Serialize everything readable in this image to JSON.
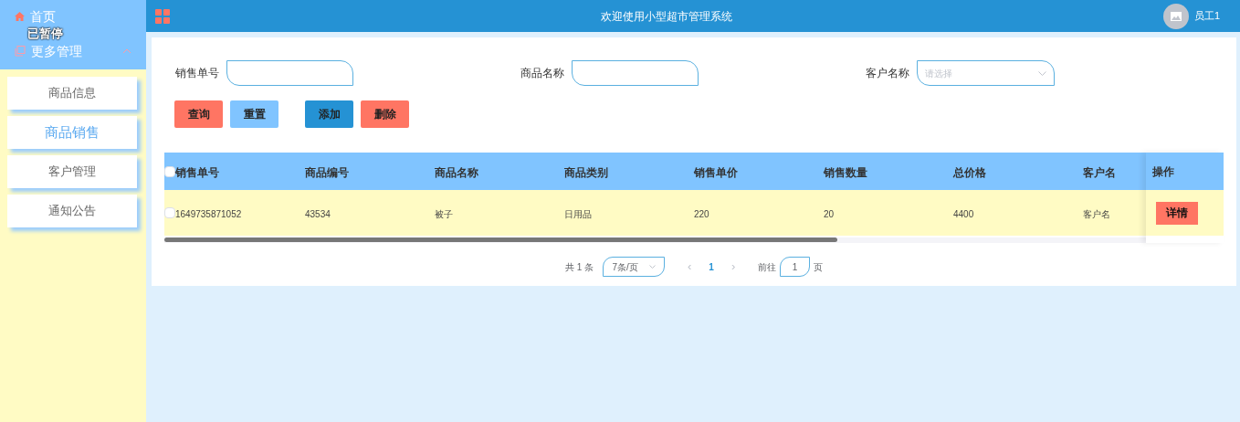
{
  "sidebar": {
    "home": "首页",
    "overlay": "已暂停",
    "group": {
      "label": "更多管理",
      "expanded": true
    },
    "items": [
      {
        "label": "商品信息",
        "selected": false
      },
      {
        "label": "商品销售",
        "selected": true
      },
      {
        "label": "客户管理",
        "selected": false
      },
      {
        "label": "通知公告",
        "selected": false
      }
    ]
  },
  "header": {
    "title": "欢迎使用小型超市管理系统",
    "user": "员工1"
  },
  "filters": [
    {
      "label": "销售单号",
      "kind": "input"
    },
    {
      "label": "商品名称",
      "kind": "input"
    },
    {
      "label": "客户名称",
      "kind": "select",
      "placeholder": "请选择"
    }
  ],
  "buttons": [
    {
      "label": "查询",
      "kind": "danger"
    },
    {
      "label": "重置",
      "kind": "light"
    },
    {
      "label": "添加",
      "kind": "primary"
    },
    {
      "label": "删除",
      "kind": "danger"
    }
  ],
  "table": {
    "all_checked": false,
    "columns": [
      "销售单号",
      "商品编号",
      "商品名称",
      "商品类别",
      "销售单价",
      "销售数量",
      "总价格",
      "客户名"
    ],
    "action_column": "操作",
    "rows": [
      {
        "checked": false,
        "cells": [
          "1649735871052",
          "43534",
          "被子",
          "日用品",
          "220",
          "20",
          "4400",
          "客户名"
        ],
        "action": "详情"
      }
    ]
  },
  "pagination": {
    "total": "共 1 条",
    "page_size": "7条/页",
    "prev": "‹",
    "pages": [
      {
        "label": "1",
        "selected": true
      }
    ],
    "next": "›",
    "goto_label": "前往",
    "goto_value": "1",
    "goto_suffix": "页"
  }
}
